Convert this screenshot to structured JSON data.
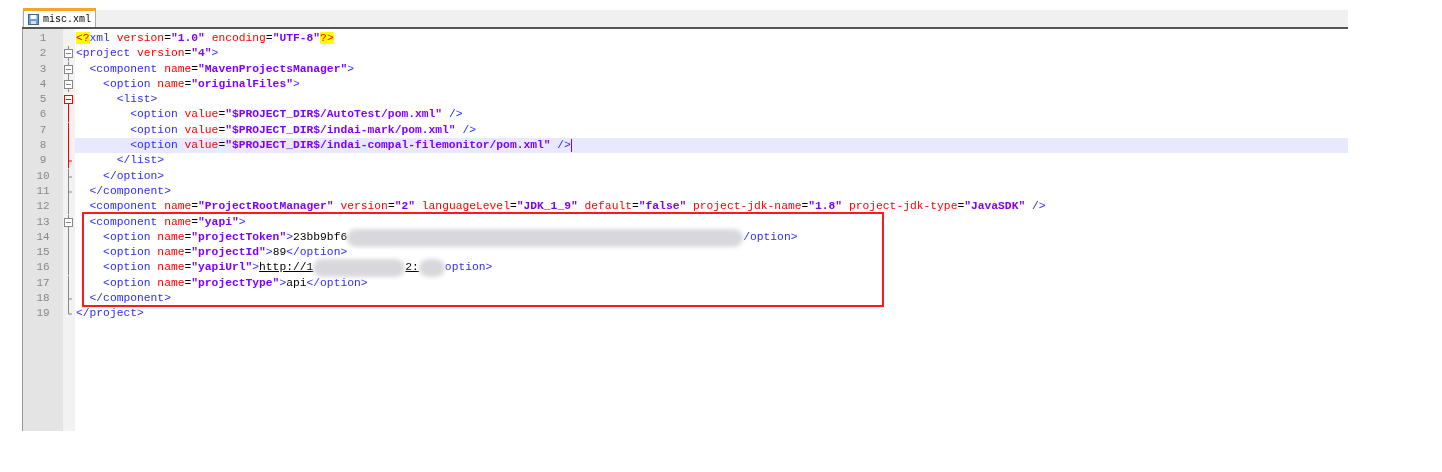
{
  "tab": {
    "label": "misc.xml",
    "selected": true
  },
  "lines": [
    {
      "number": "1",
      "kind": "plain",
      "active": false,
      "current": false,
      "tokens": [
        {
          "kind": "pi",
          "text": "<?"
        },
        {
          "kind": "tag",
          "text": "xml "
        },
        {
          "kind": "attr",
          "text": "version"
        },
        {
          "kind": "eq",
          "text": "="
        },
        {
          "kind": "value",
          "text": "\"1.0\" "
        },
        {
          "kind": "attr",
          "text": "encoding"
        },
        {
          "kind": "eq",
          "text": "="
        },
        {
          "kind": "value",
          "text": "\"UTF-8\""
        },
        {
          "kind": "pi",
          "text": "?>"
        }
      ]
    },
    {
      "number": "2",
      "kind": "foldstart",
      "active": false,
      "current": false,
      "tokens": [
        {
          "kind": "tag",
          "text": "<project "
        },
        {
          "kind": "attr",
          "text": "version"
        },
        {
          "kind": "eq",
          "text": "="
        },
        {
          "kind": "value",
          "text": "\"4\""
        },
        {
          "kind": "tag",
          "text": ">"
        }
      ]
    },
    {
      "number": "3",
      "kind": "foldstart",
      "active": false,
      "current": false,
      "tokens": [
        {
          "kind": "tag",
          "text": "  <component "
        },
        {
          "kind": "attr",
          "text": "name"
        },
        {
          "kind": "eq",
          "text": "="
        },
        {
          "kind": "value",
          "text": "\"MavenProjectsManager\""
        },
        {
          "kind": "tag",
          "text": ">"
        }
      ]
    },
    {
      "number": "4",
      "kind": "foldstart",
      "active": false,
      "current": false,
      "tokens": [
        {
          "kind": "tag",
          "text": "    <option "
        },
        {
          "kind": "attr",
          "text": "name"
        },
        {
          "kind": "eq",
          "text": "="
        },
        {
          "kind": "value",
          "text": "\"originalFiles\""
        },
        {
          "kind": "tag",
          "text": ">"
        }
      ]
    },
    {
      "number": "5",
      "kind": "foldstart",
      "active": true,
      "current": false,
      "tokens": [
        {
          "kind": "tag",
          "text": "      <list>"
        }
      ]
    },
    {
      "number": "6",
      "kind": "foldmid",
      "active": true,
      "current": false,
      "tokens": [
        {
          "kind": "tag",
          "text": "        <option "
        },
        {
          "kind": "attr",
          "text": "value"
        },
        {
          "kind": "eq",
          "text": "="
        },
        {
          "kind": "value",
          "text": "\"$PROJECT_DIR$/AutoTest/pom.xml\" "
        },
        {
          "kind": "tag",
          "text": "/>"
        }
      ]
    },
    {
      "number": "7",
      "kind": "foldmid",
      "active": true,
      "current": false,
      "tokens": [
        {
          "kind": "tag",
          "text": "        <option "
        },
        {
          "kind": "attr",
          "text": "value"
        },
        {
          "kind": "eq",
          "text": "="
        },
        {
          "kind": "value",
          "text": "\"$PROJECT_DIR$/indai-mark/pom.xml\" "
        },
        {
          "kind": "tag",
          "text": "/>"
        }
      ]
    },
    {
      "number": "8",
      "kind": "foldmid",
      "active": true,
      "current": true,
      "tokens": [
        {
          "kind": "tag",
          "text": "        <option "
        },
        {
          "kind": "attr",
          "text": "value"
        },
        {
          "kind": "eq",
          "text": "="
        },
        {
          "kind": "value",
          "text": "\"$PROJECT_DIR$/indai-compal-filemonitor/pom.xml\" "
        },
        {
          "kind": "tag",
          "text": "/>"
        }
      ]
    },
    {
      "number": "9",
      "kind": "foldend",
      "active": true,
      "current": false,
      "tokens": [
        {
          "kind": "tag",
          "text": "      </list>"
        }
      ]
    },
    {
      "number": "10",
      "kind": "foldend",
      "active": false,
      "current": false,
      "tokens": [
        {
          "kind": "tag",
          "text": "    </option>"
        }
      ]
    },
    {
      "number": "11",
      "kind": "foldend",
      "active": false,
      "current": false,
      "tokens": [
        {
          "kind": "tag",
          "text": "  </component>"
        }
      ]
    },
    {
      "number": "12",
      "kind": "foldmid",
      "active": false,
      "current": false,
      "tokens": [
        {
          "kind": "tag",
          "text": "  <component "
        },
        {
          "kind": "attr",
          "text": "name"
        },
        {
          "kind": "eq",
          "text": "="
        },
        {
          "kind": "value",
          "text": "\"ProjectRootManager\" "
        },
        {
          "kind": "attr",
          "text": "version"
        },
        {
          "kind": "eq",
          "text": "="
        },
        {
          "kind": "value",
          "text": "\"2\" "
        },
        {
          "kind": "attr",
          "text": "languageLevel"
        },
        {
          "kind": "eq",
          "text": "="
        },
        {
          "kind": "value",
          "text": "\"JDK_1_9\" "
        },
        {
          "kind": "attr",
          "text": "default"
        },
        {
          "kind": "eq",
          "text": "="
        },
        {
          "kind": "value",
          "text": "\"false\" "
        },
        {
          "kind": "attr",
          "text": "project-jdk-name"
        },
        {
          "kind": "eq",
          "text": "="
        },
        {
          "kind": "value",
          "text": "\"1.8\" "
        },
        {
          "kind": "attr",
          "text": "project-jdk-type"
        },
        {
          "kind": "eq",
          "text": "="
        },
        {
          "kind": "value",
          "text": "\"JavaSDK\" "
        },
        {
          "kind": "tag",
          "text": "/>"
        }
      ]
    },
    {
      "number": "13",
      "kind": "foldstart",
      "active": false,
      "current": false,
      "tokens": [
        {
          "kind": "tag",
          "text": "  <component "
        },
        {
          "kind": "attr",
          "text": "name"
        },
        {
          "kind": "eq",
          "text": "="
        },
        {
          "kind": "value",
          "text": "\"yapi\""
        },
        {
          "kind": "tag",
          "text": ">"
        }
      ]
    },
    {
      "number": "14",
      "kind": "foldmid",
      "active": false,
      "current": false,
      "tokens": [
        {
          "kind": "tag",
          "text": "    <option "
        },
        {
          "kind": "attr",
          "text": "name"
        },
        {
          "kind": "eq",
          "text": "="
        },
        {
          "kind": "value",
          "text": "\"projectToken\""
        },
        {
          "kind": "tag",
          "text": ">"
        },
        {
          "kind": "text",
          "text": "23bb9bf6"
        },
        {
          "kind": "redacted"
        },
        {
          "kind": "tag",
          "text": "/option>"
        }
      ]
    },
    {
      "number": "15",
      "kind": "foldmid",
      "active": false,
      "current": false,
      "tokens": [
        {
          "kind": "tag",
          "text": "    <option "
        },
        {
          "kind": "attr",
          "text": "name"
        },
        {
          "kind": "eq",
          "text": "="
        },
        {
          "kind": "value",
          "text": "\"projectId\""
        },
        {
          "kind": "tag",
          "text": ">"
        },
        {
          "kind": "text",
          "text": "89"
        },
        {
          "kind": "tag",
          "text": "</option>"
        }
      ]
    },
    {
      "number": "16",
      "kind": "foldmid",
      "active": false,
      "current": false,
      "tokens": [
        {
          "kind": "tag",
          "text": "    <option "
        },
        {
          "kind": "attr",
          "text": "name"
        },
        {
          "kind": "eq",
          "text": "="
        },
        {
          "kind": "value",
          "text": "\"yapiUrl\""
        },
        {
          "kind": "tag",
          "text": ">"
        },
        {
          "kind": "link",
          "text": "http://1"
        },
        {
          "kind": "redacted"
        },
        {
          "kind": "link",
          "text": "2:"
        },
        {
          "kind": "redacted"
        },
        {
          "kind": "tag",
          "text": "option>"
        }
      ]
    },
    {
      "number": "17",
      "kind": "foldmid",
      "active": false,
      "current": false,
      "tokens": [
        {
          "kind": "tag",
          "text": "    <option "
        },
        {
          "kind": "attr",
          "text": "name"
        },
        {
          "kind": "eq",
          "text": "="
        },
        {
          "kind": "value",
          "text": "\"projectType\""
        },
        {
          "kind": "tag",
          "text": ">"
        },
        {
          "kind": "text",
          "text": "api"
        },
        {
          "kind": "tag",
          "text": "</option>"
        }
      ]
    },
    {
      "number": "18",
      "kind": "foldend",
      "active": false,
      "current": false,
      "tokens": [
        {
          "kind": "tag",
          "text": "  </component>"
        }
      ]
    },
    {
      "number": "19",
      "kind": "foldlast",
      "active": false,
      "current": false,
      "tokens": [
        {
          "kind": "tag",
          "text": "</project>"
        }
      ]
    }
  ]
}
